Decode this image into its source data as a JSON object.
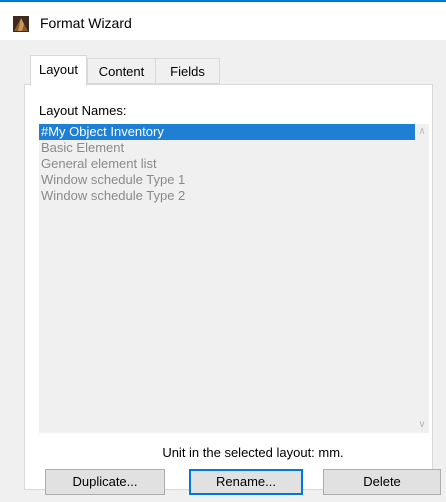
{
  "window": {
    "title": "Format Wizard",
    "icon": "archicad-app-icon"
  },
  "tabs": [
    {
      "label": "Layout",
      "active": true
    },
    {
      "label": "Content",
      "active": false
    },
    {
      "label": "Fields",
      "active": false
    }
  ],
  "layout_panel": {
    "section_label": "Layout Names:",
    "items": [
      {
        "label": "#My Object Inventory",
        "selected": true
      },
      {
        "label": "Basic Element",
        "selected": false
      },
      {
        "label": "General element list",
        "selected": false
      },
      {
        "label": "Window schedule Type 1",
        "selected": false
      },
      {
        "label": "Window schedule Type 2",
        "selected": false
      }
    ],
    "unit_text": "Unit in the selected layout: mm."
  },
  "buttons": {
    "duplicate": "Duplicate...",
    "rename": "Rename...",
    "delete": "Delete"
  },
  "colors": {
    "accent": "#0078d7",
    "selection": "#1f7fd4",
    "list_background": "#f0f0f0",
    "disabled_text": "#8a8a8a"
  }
}
